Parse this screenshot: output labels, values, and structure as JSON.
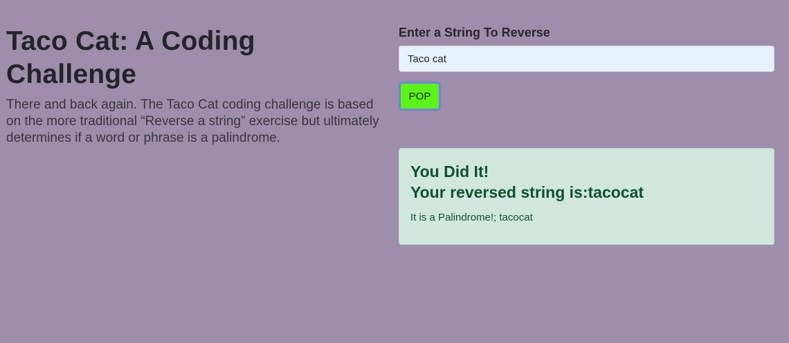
{
  "header": {
    "title": "Taco Cat: A Coding Challenge",
    "lead": "There and back again. The Taco Cat coding challenge is based on the more traditional “Reverse a string” exercise but ultimately determines if a word or phrase is a palindrome."
  },
  "form": {
    "label": "Enter a String To Reverse",
    "input_value": "Taco cat",
    "button_label": "POP"
  },
  "result": {
    "heading_line1": "You Did It!",
    "heading_line2": "Your reversed string is:tacocat",
    "message": "It is a Palindrome!; tacocat"
  },
  "colors": {
    "background": "#9e8dab",
    "button": "#5bf31a",
    "button_border": "#6f86d8",
    "alert_background": "#d1e7dd",
    "alert_text": "#0f5132",
    "input_background": "#e8f0fe"
  }
}
